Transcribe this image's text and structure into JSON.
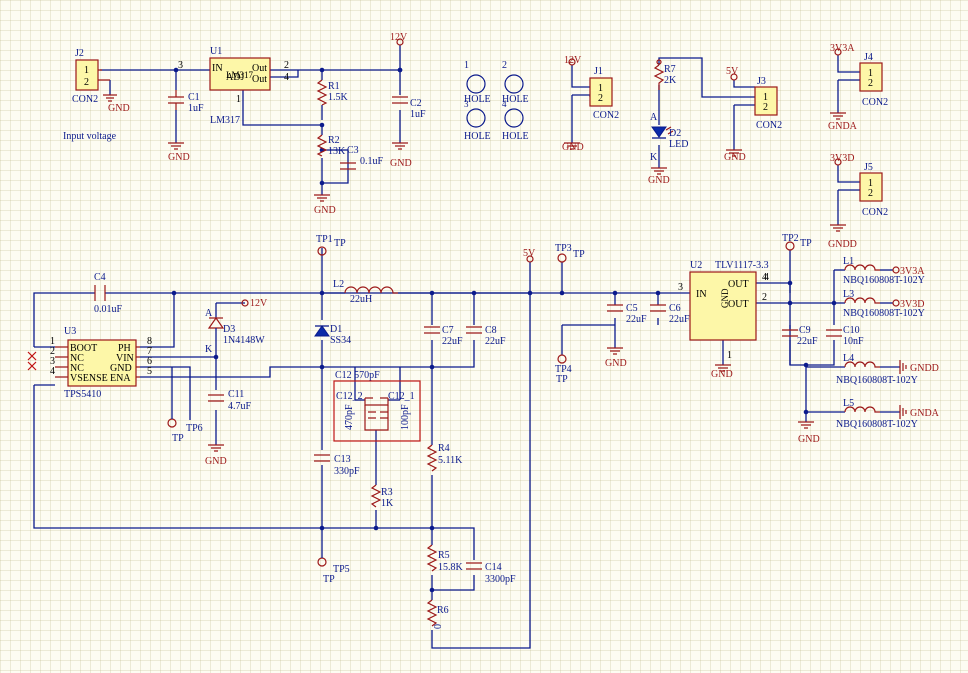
{
  "labels": {
    "input_voltage": "Input voltage"
  },
  "nets": {
    "gnd": "GND",
    "v12": "12V",
    "v5": "5V",
    "v3a": "3V3A",
    "v3d": "3V3D",
    "gnda": "GNDA",
    "gndd": "GNDD"
  },
  "pins": {
    "u1_in_num": "3",
    "u1_out1_num": "2",
    "u1_out2_num": "4",
    "u1_adj_num": "1",
    "u2_in_num": "3",
    "u2_out1_num": "4",
    "u2_out2_num": "2",
    "u2_gnd_num": "1"
  },
  "holes": {
    "label": "HOLE",
    "h1_num": "1",
    "h2_num": "2",
    "h3_num": "3",
    "h4_num": "4"
  },
  "components": {
    "j2": {
      "ref": "J2",
      "value": "CON2"
    },
    "c1": {
      "ref": "C1",
      "value": "1uF"
    },
    "u1": {
      "ref": "U1",
      "value": "LM317",
      "inner_label": "LM317",
      "pin_in": "IN",
      "pin_adj": "ADJ",
      "pin_out1": "Out",
      "pin_out2": "Out"
    },
    "r1": {
      "ref": "R1",
      "value": "1.5K"
    },
    "r2": {
      "ref": "R2",
      "value": "13K"
    },
    "c3": {
      "ref": "C3",
      "value": "0.1uF"
    },
    "c2": {
      "ref": "C2",
      "value": "1uF"
    },
    "j1": {
      "ref": "J1",
      "value": "CON2"
    },
    "r7": {
      "ref": "R7",
      "value": "2K"
    },
    "d2": {
      "ref": "D2",
      "value": "LED",
      "anode": "A",
      "cathode": "K"
    },
    "j3": {
      "ref": "J3",
      "value": "CON2"
    },
    "j4": {
      "ref": "J4",
      "value": "CON2"
    },
    "j5": {
      "ref": "J5",
      "value": "CON2"
    },
    "c4": {
      "ref": "C4",
      "value": "0.01uF"
    },
    "u3": {
      "ref": "U3",
      "value": "TPS5410",
      "pins": [
        "BOOT",
        "NC",
        "NC",
        "VSENSE",
        "PH",
        "VIN",
        "GND",
        "ENA"
      ]
    },
    "tp6": {
      "ref": "TP6",
      "value": "TP"
    },
    "d3": {
      "ref": "D3",
      "value": "1N4148W",
      "anode": "A",
      "cathode": "K"
    },
    "c11": {
      "ref": "C11",
      "value": "4.7uF"
    },
    "tp1": {
      "ref": "TP1",
      "value": "TP"
    },
    "d1": {
      "ref": "D1",
      "value": "SS34"
    },
    "l2": {
      "ref": "L2",
      "value": "22uH"
    },
    "c7": {
      "ref": "C7",
      "value": "22uF"
    },
    "c8": {
      "ref": "C8",
      "value": "22uF"
    },
    "c12": {
      "label": "C12 570pF",
      "sub1_ref": "C12_2",
      "sub2_ref": "C12_1",
      "sub1_value": "470pF",
      "sub2_value": "100pF"
    },
    "c13": {
      "ref": "C13",
      "value": "330pF"
    },
    "r3": {
      "ref": "R3",
      "value": "1K"
    },
    "r4": {
      "ref": "R4",
      "value": "5.11K"
    },
    "tp5": {
      "ref": "TP5",
      "value": "TP"
    },
    "r5": {
      "ref": "R5",
      "value": "15.8K"
    },
    "c14": {
      "ref": "C14",
      "value": "3300pF"
    },
    "r6": {
      "ref": "R6",
      "value": "0"
    },
    "tp3": {
      "ref": "TP3",
      "value": "TP"
    },
    "tp4": {
      "ref": "TP4",
      "value": "TP"
    },
    "c5": {
      "ref": "C5",
      "value": "22uF"
    },
    "c6": {
      "ref": "C6",
      "value": "22uF"
    },
    "u2": {
      "ref": "U2",
      "value": "TLV1117-3.3",
      "pin_in": "IN",
      "pin_out": "OUT",
      "pin_gnd": "GND"
    },
    "tp2": {
      "ref": "TP2",
      "value": "TP"
    },
    "c9": {
      "ref": "C9",
      "value": "22uF"
    },
    "c10": {
      "ref": "C10",
      "value": "10nF"
    },
    "l1": {
      "ref": "L1",
      "value": "NBQ160808T-102Y"
    },
    "l3": {
      "ref": "L3",
      "value": "NBQ160808T-102Y"
    },
    "l4": {
      "ref": "L4",
      "value": "NBQ160808T-102Y"
    },
    "l5": {
      "ref": "L5",
      "value": "NBQ160808T-102Y"
    }
  }
}
